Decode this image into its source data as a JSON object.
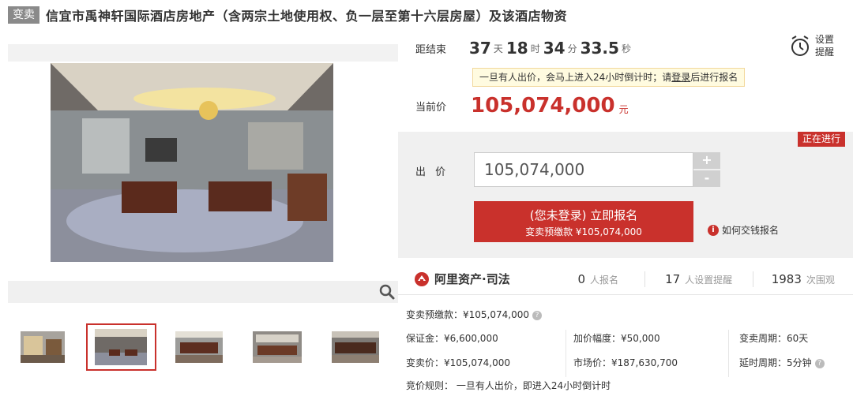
{
  "header": {
    "tag": "变卖",
    "title": "信宜市禹神轩国际酒店房地产（含两宗土地使用权、负一层至第十六层房屋）及该酒店物资"
  },
  "countdown": {
    "label": "距结束",
    "days": "37",
    "days_unit": "天",
    "hours": "18",
    "hours_unit": "时",
    "minutes": "34",
    "minutes_unit": "分",
    "seconds": "33.5",
    "seconds_unit": "秒"
  },
  "reminder": {
    "label": "设置提醒"
  },
  "notice": {
    "text_before": "一旦有人出价，会马上进入24小时倒计时；请",
    "link": "登录",
    "text_after": "后进行报名"
  },
  "current_price": {
    "label": "当前价",
    "value": "105,074,000",
    "unit": "元"
  },
  "bid": {
    "status": "正在进行",
    "label": "出 价",
    "input_value": "105,074,000",
    "plus": "+",
    "minus": "-",
    "apply_main": "(您未登录) 立即报名",
    "apply_sub": "变卖预缴款 ¥105,074,000",
    "howto": "如何交钱报名"
  },
  "stats": {
    "brand": "阿里资产·司法",
    "signups": "0",
    "signups_label": "人报名",
    "reminders": "17",
    "reminders_label": "人设置提醒",
    "views": "1983",
    "views_label": "次围观"
  },
  "info": {
    "deposit_prepay": "变卖预缴款：¥105,074,000",
    "margin": "保证金：¥6,600,000",
    "increment": "加价幅度：¥50,000",
    "period": "变卖周期：60天",
    "sale_price": "变卖价：¥105,074,000",
    "market_price": "市场价：¥187,630,700",
    "delay": "延时周期：5分钟",
    "rule": "竞价规则：  一旦有人出价，即进入24小时倒计时"
  },
  "colors": {
    "accent": "#c9312c",
    "tag_bg": "#8a8a8a",
    "notice_bg": "#fffbe0"
  },
  "icons": {
    "zoom": "magnifier-icon",
    "alarm": "alarm-clock-icon",
    "info": "info-icon",
    "brand": "ali-assets-logo-icon"
  }
}
